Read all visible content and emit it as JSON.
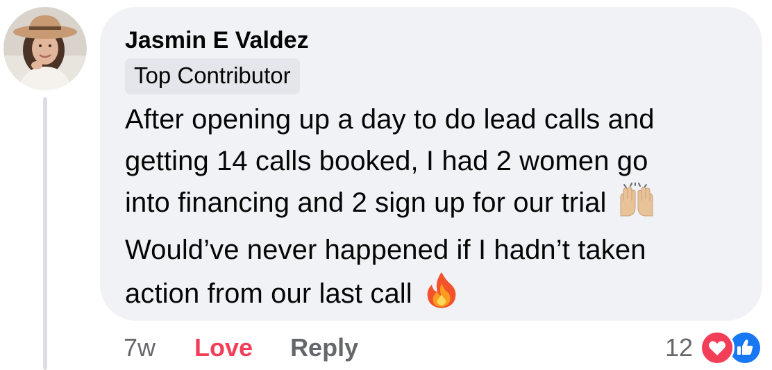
{
  "comment": {
    "author": "Jasmin E Valdez",
    "badge": "Top Contributor",
    "text_lines": [
      "After opening up a day to do lead calls and",
      "getting 14 calls booked, I had 2 women go",
      "into financing and 2 sign up for our trial",
      "Would’ve never happened if I hadn’t taken",
      "action from our last call"
    ],
    "emojis": {
      "line3": "raising-hands-icon",
      "line5": "fire-icon"
    }
  },
  "actions": {
    "time": "7w",
    "love_label": "Love",
    "reply_label": "Reply"
  },
  "reactions": {
    "count": "12",
    "types": [
      "love-reaction-icon",
      "like-reaction-icon"
    ],
    "colors": {
      "love": "#f33e58",
      "like": "#1877f2"
    }
  },
  "colors": {
    "bubble": "#f0f2f5",
    "badge_bg": "#e4e6eb",
    "secondary_text": "#65676b",
    "thread_line": "#dcdfe4"
  }
}
